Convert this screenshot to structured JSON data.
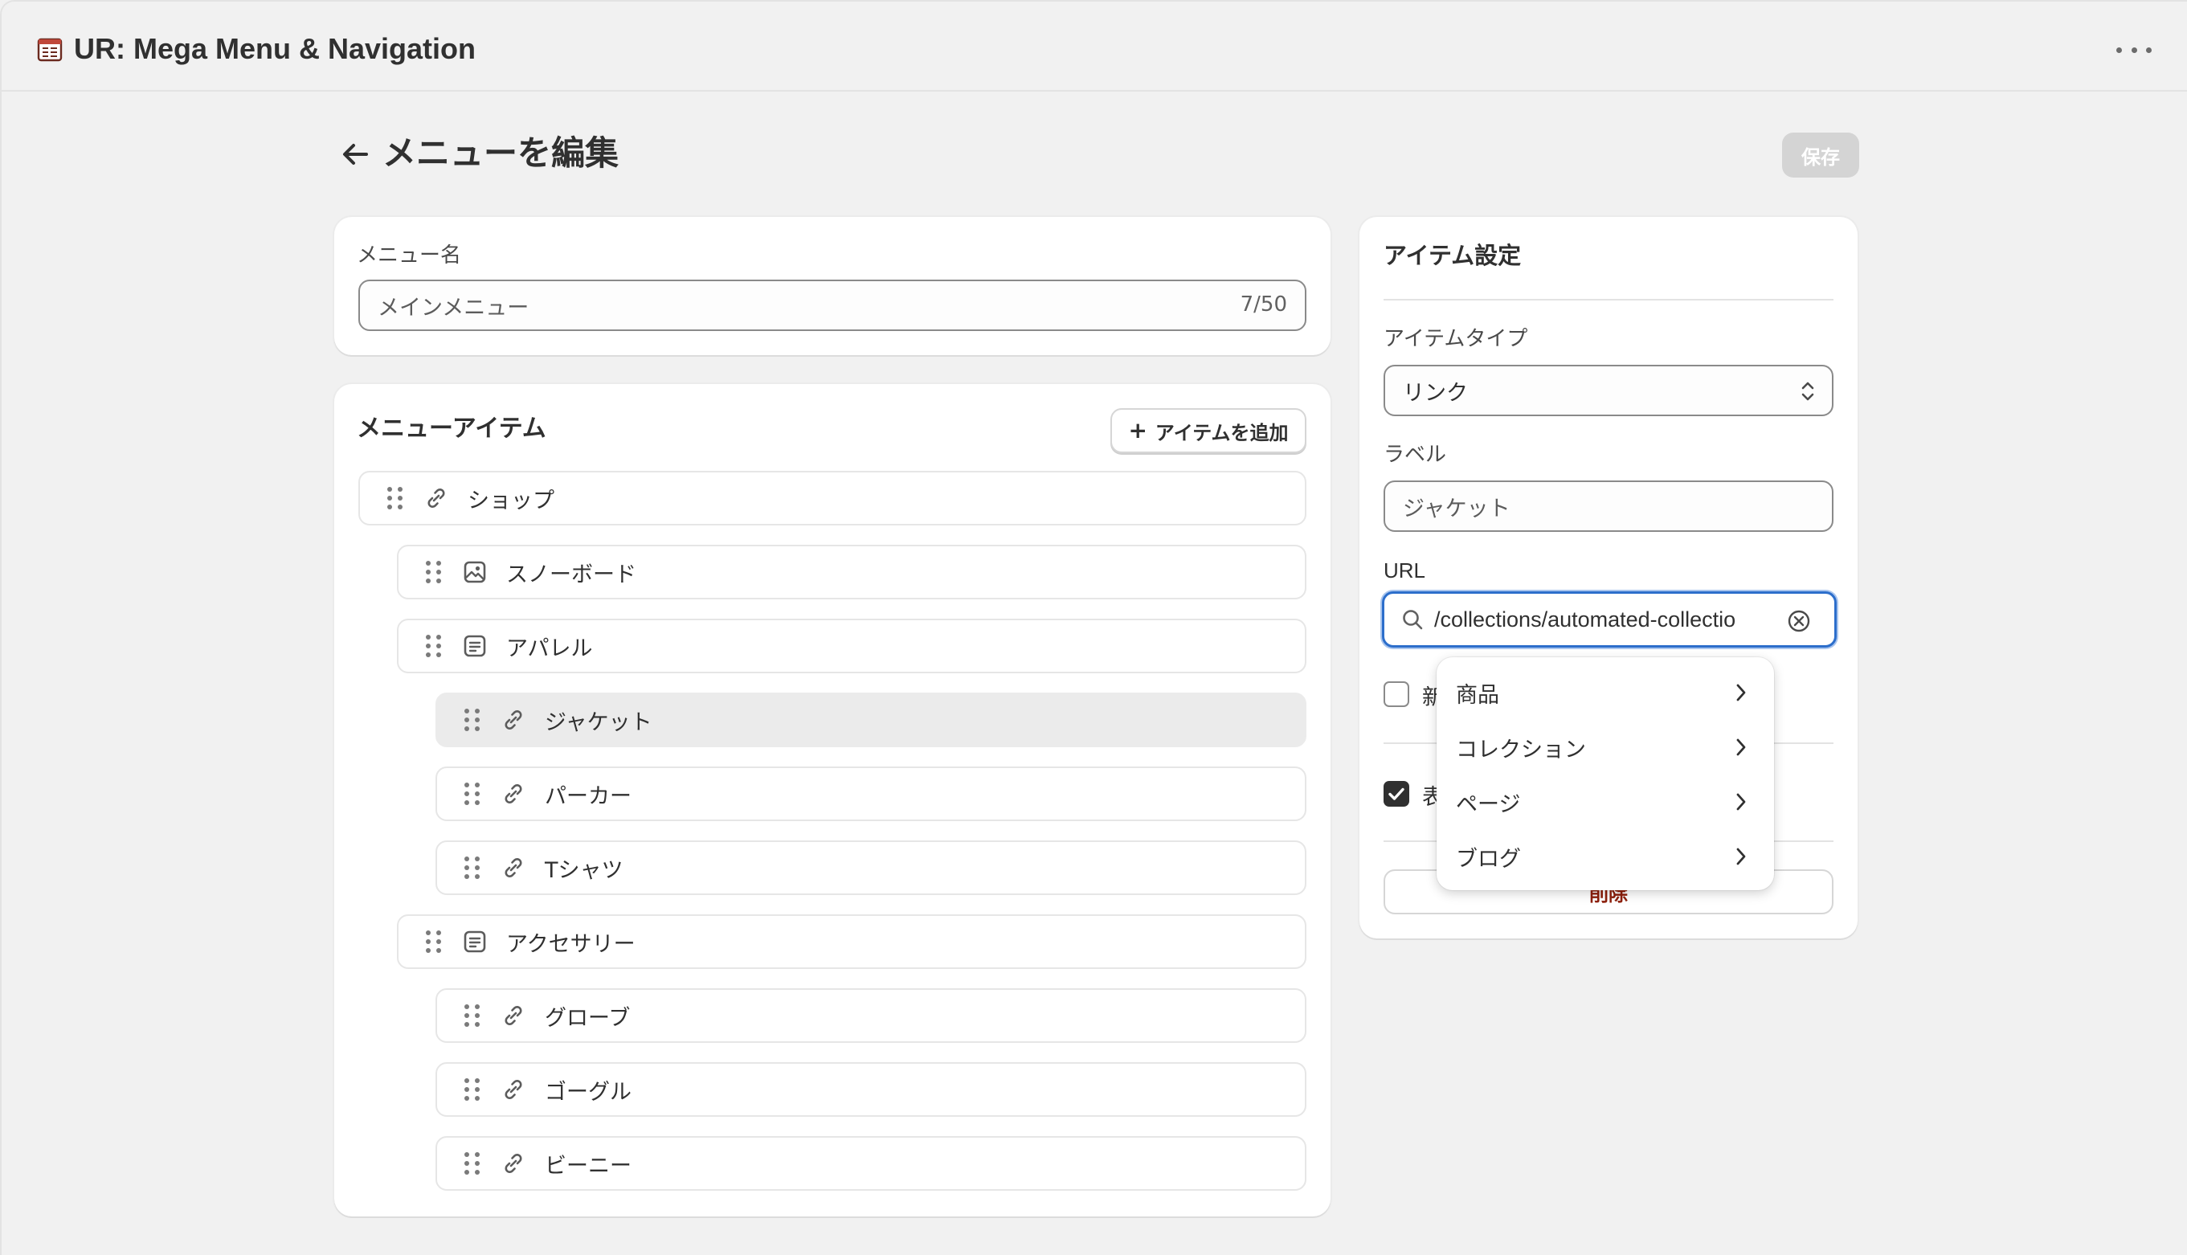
{
  "app": {
    "title": "UR: Mega Menu & Navigation",
    "icon": "app-table-icon",
    "more_icon": "more-horizontal-icon"
  },
  "page": {
    "title": "メニューを編集",
    "back_icon": "arrow-left-icon",
    "save_label": "保存"
  },
  "menu_name": {
    "label": "メニュー名",
    "value": "メインメニュー",
    "counter": "7/50"
  },
  "menu_items": {
    "title": "メニューアイテム",
    "add_label": "アイテムを追加",
    "items": [
      {
        "label": "ショップ",
        "icon": "link-icon",
        "level": 0,
        "selected": false
      },
      {
        "label": "スノーボード",
        "icon": "image-icon",
        "level": 1,
        "selected": false
      },
      {
        "label": "アパレル",
        "icon": "page-icon",
        "level": 1,
        "selected": false
      },
      {
        "label": "ジャケット",
        "icon": "link-icon",
        "level": 2,
        "selected": true
      },
      {
        "label": "パーカー",
        "icon": "link-icon",
        "level": 2,
        "selected": false
      },
      {
        "label": "Tシャツ",
        "icon": "link-icon",
        "level": 2,
        "selected": false
      },
      {
        "label": "アクセサリー",
        "icon": "page-icon",
        "level": 1,
        "selected": false
      },
      {
        "label": "グローブ",
        "icon": "link-icon",
        "level": 2,
        "selected": false
      },
      {
        "label": "ゴーグル",
        "icon": "link-icon",
        "level": 2,
        "selected": false
      },
      {
        "label": "ビーニー",
        "icon": "link-icon",
        "level": 2,
        "selected": false
      }
    ]
  },
  "settings": {
    "title": "アイテム設定",
    "type_label": "アイテムタイプ",
    "type_value": "リンク",
    "label_label": "ラベル",
    "label_value": "ジャケット",
    "url_label": "URL",
    "url_value": "/collections/automated-collectio",
    "checkbox1_label": "新",
    "checkbox1_checked": false,
    "checkbox2_label": "表",
    "checkbox2_checked": true,
    "delete_label": "削除"
  },
  "url_dropdown": {
    "items": [
      {
        "label": "商品"
      },
      {
        "label": "コレクション"
      },
      {
        "label": "ページ"
      },
      {
        "label": "ブログ"
      }
    ]
  },
  "colors": {
    "background": "#f1f1f1",
    "card": "#ffffff",
    "focus": "#2c6ecb",
    "danger": "#8e1f0b",
    "selected_row": "#ebebeb"
  }
}
